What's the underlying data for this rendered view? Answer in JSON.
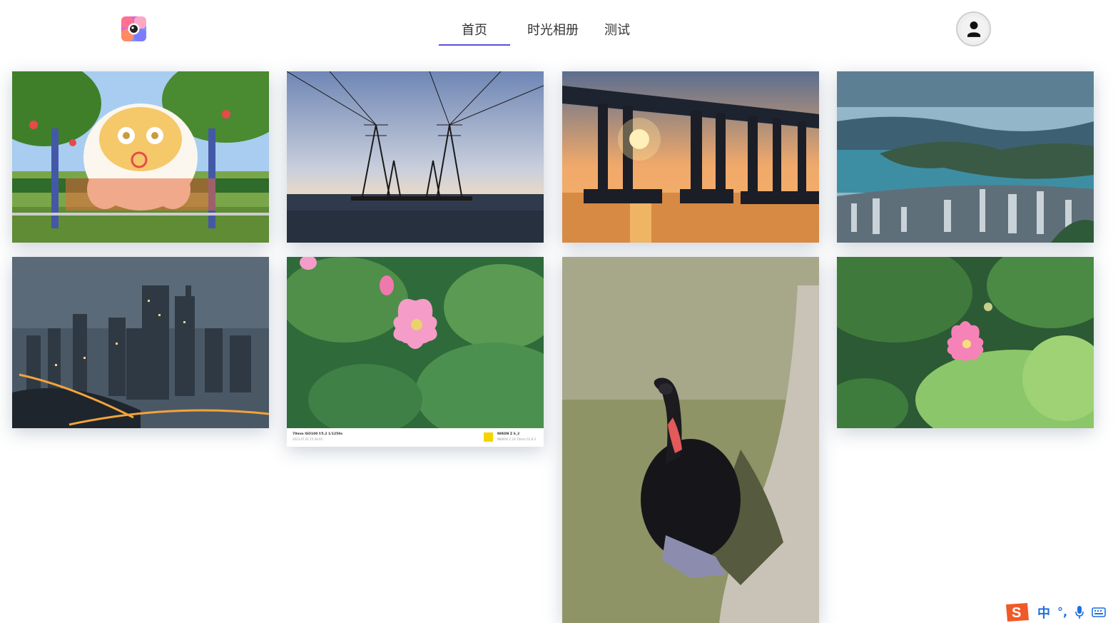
{
  "nav": {
    "home": "首页",
    "album": "时光相册",
    "test": "测试"
  },
  "colors": {
    "nav_active_underline": "#5b4fd8",
    "ime_blue": "#1f6fde",
    "ime_logo": "#f05a28"
  },
  "photos": [
    {
      "subject": "inflatable mascot in park"
    },
    {
      "subject": "power transmission towers over sea"
    },
    {
      "subject": "bridge silhouette at sunset"
    },
    {
      "subject": "aerial view of coastal city and islands"
    },
    {
      "subject": "city skyline at dusk"
    },
    {
      "subject": "pink lotus among leaves"
    },
    {
      "subject": "black swan on stone ledge"
    },
    {
      "subject": "pink lotus with large green leaves"
    }
  ],
  "exif_caption": {
    "left_line1": "70mm ISO100 f/5.2 1/1250s",
    "left_line2": "2023.07.01 15:34:05",
    "right_line1": "NIKON Z 6_2",
    "right_line2": "NIKKOR Z 24-70mm f/2.8 S"
  },
  "ime": {
    "chinese_mode": "中",
    "punctuation": "°,",
    "icons": [
      "sogou-logo-icon",
      "microphone-icon",
      "keyboard-icon"
    ]
  }
}
